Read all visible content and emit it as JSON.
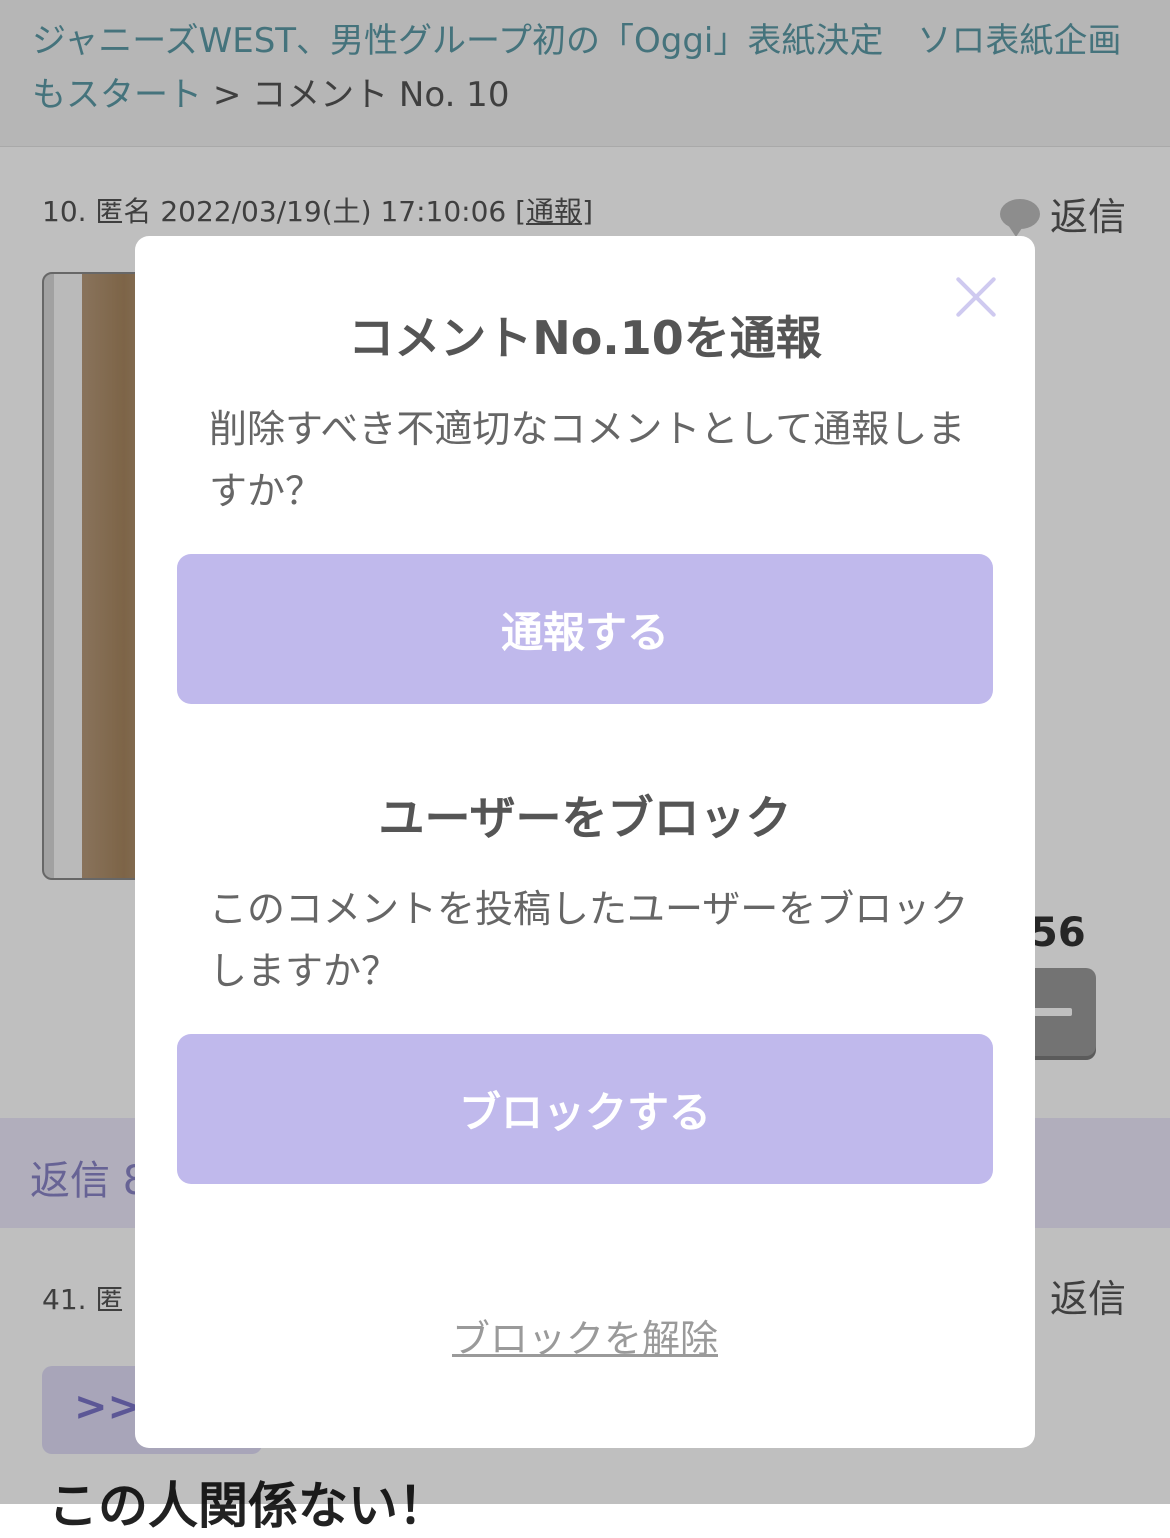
{
  "header": {
    "article_title": "ジャニーズWEST、男性グループ初の「Oggi」表紙決定　ソロ表紙企画もスタート",
    "separator": ">",
    "current": "コメント No. 10"
  },
  "comment10": {
    "meta_prefix": "10. 匿名 2022/03/19(土) 17:10:06 [",
    "report_label": "通報",
    "meta_suffix": "]",
    "reply_label": "返信",
    "vote_count_partial": "56"
  },
  "replies_band": {
    "label_partial": "返信 8"
  },
  "comment41": {
    "meta_partial": "41. 匿",
    "reply_label": "返信",
    "anchor_partial": ">>",
    "body_partial": "この人関係ない！"
  },
  "modal": {
    "report_title": "コメントNo.10を通報",
    "report_text": "削除すべき不適切なコメントとして通報しますか？",
    "report_button": "通報する",
    "block_title": "ユーザーをブロック",
    "block_text": "このコメントを投稿したユーザーをブロックしますか？",
    "block_button": "ブロックする",
    "unblock_link": "ブロックを解除"
  },
  "colors": {
    "accent_button": "#c0b9ec",
    "link_teal": "#5c9aa6",
    "close_icon": "#cfcaf0"
  }
}
